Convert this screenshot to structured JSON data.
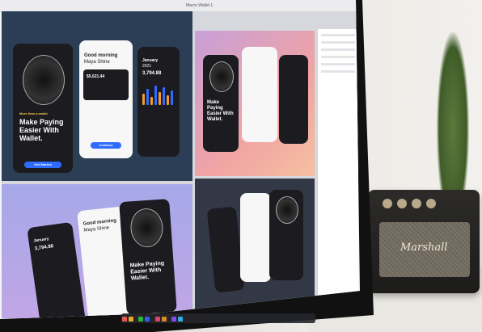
{
  "screen_title": "Macro Wallet 1",
  "wallet_tagline": "Make Paying Easier With Wallet.",
  "wallet_kicker": "More than a wallet",
  "greeting": "Good morning",
  "user_name": "Maya Shine",
  "card_balance": "$5,621.44",
  "chart_month": "January",
  "chart_year": "2021",
  "chart_amount": "3,794.88",
  "cta_button": "Get Started",
  "continue_button": "Continue",
  "speaker_brand": "Marshall",
  "colors": {
    "accent_blue": "#2f6bff",
    "bar_orange": "#f59a2b",
    "bar_blue": "#2f6bff"
  }
}
